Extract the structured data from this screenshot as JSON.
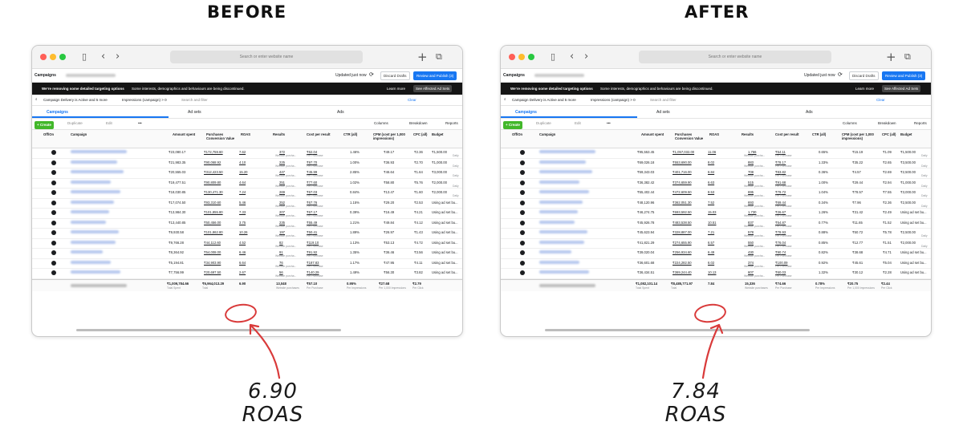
{
  "labels": {
    "before": "BEFORE",
    "after": "AFTER"
  },
  "annotations": {
    "before": {
      "value": "6.90",
      "unit": "ROAS"
    },
    "after": {
      "value": "7.84",
      "unit": "ROAS"
    }
  },
  "browser": {
    "address_placeholder": "Search or enter website name"
  },
  "manager": {
    "section": "Campaigns",
    "status": "Updated just now",
    "discard": "Discard Drafts",
    "review": "Review and Publish (3)",
    "notice_bold": "We're removing some detailed targeting options",
    "notice_text": "Some interests, demographics and behaviours are being discontinued.",
    "learn_more": "Learn more",
    "see_affected": "See Affected Ad Sets",
    "filter_chip1": "Campaign Delivery is Active and 5 more",
    "filter_chip2": "Impressions (campaign) > 0",
    "filter_hint": "Search and filter",
    "clear": "Clear",
    "tabs": [
      "Campaigns",
      "Ad sets",
      "Ads"
    ],
    "create": "+ Create",
    "duplicate": "Duplicate",
    "edit": "Edit",
    "more": "•••",
    "columns": "Columns",
    "breakdown": "Breakdown",
    "reports": "Reports",
    "headers": [
      "Off/On",
      "Campaign",
      "Amount spent",
      "Purchases Conversion Value",
      "ROAS",
      "Results",
      "Cost per result",
      "CTR (all)",
      "CPM (cost per 1,000 impressions)",
      "CPC (all)",
      "Budget"
    ],
    "results_sub": "Website purcha...",
    "cost_sub": "Per Purchase",
    "budget_sub": "Daily",
    "total_label": "Results from 1 campaign",
    "total_subs": [
      "Total Spent",
      "Total",
      "",
      "Website purchases",
      "Per Purchase",
      "Per Impressions",
      "Per 1,000 Impressions",
      "Per Click"
    ]
  },
  "before_table": {
    "rows": [
      [
        "₹23,080.17",
        "₹172,759.60",
        "7.62",
        "372",
        "₹62.04",
        "1.46%",
        "₹49.17",
        "₹2.36",
        "₹1,500.00"
      ],
      [
        "₹21,983.35",
        "₹90,068.92",
        "4.10",
        "225",
        "₹97.70",
        "1.00%",
        "₹36.93",
        "₹2.70",
        "₹1,000.00"
      ],
      [
        "₹20,555.03",
        "₹312,423.50",
        "15.20",
        "447",
        "₹45.99",
        "2.85%",
        "₹46.64",
        "₹1.64",
        "₹3,000.00"
      ],
      [
        "₹19,477.51",
        "₹90,809.80",
        "4.64",
        "251",
        "₹77.60",
        "1.02%",
        "₹58.80",
        "₹5.76",
        "₹2,000.00"
      ],
      [
        "₹18,030.85",
        "₹130,471.30",
        "7.24",
        "269",
        "₹67.03",
        "0.84%",
        "₹13.47",
        "₹1.60",
        "₹2,000.00"
      ],
      [
        "₹17,074.50",
        "₹93,310.60",
        "5.46",
        "252",
        "₹67.76",
        "1.15%",
        "₹29.20",
        "₹2.53",
        "Using ad set bu..."
      ],
      [
        "₹13,984.30",
        "₹101,855.80",
        "7.33",
        "207",
        "₹67.17",
        "0.39%",
        "₹16.49",
        "₹4.21",
        "Using ad set bu..."
      ],
      [
        "₹13,440.85",
        "₹50,456.00",
        "3.75",
        "235",
        "₹55.49",
        "1.21%",
        "₹49.84",
        "₹4.12",
        "Using ad set bu..."
      ],
      [
        "₹9,930.58",
        "₹101,862.80",
        "10.26",
        "197",
        "₹50.41",
        "1.89%",
        "₹26.97",
        "₹1.43",
        "Using ad set bu..."
      ],
      [
        "₹9,766.28",
        "₹44,112.60",
        "4.52",
        "82",
        "₹119.10",
        "1.13%",
        "₹53.13",
        "₹4.72",
        "Using ad set bu..."
      ],
      [
        "₹8,364.92",
        "₹54,008.00",
        "6.46",
        "91",
        "₹91.92",
        "1.35%",
        "₹36.46",
        "₹3.56",
        "Using ad set bu..."
      ],
      [
        "₹5,194.81",
        "₹34,903.90",
        "6.64",
        "76",
        "₹187.83",
        "1.17%",
        "₹47.95",
        "₹4.11",
        "Using ad set bu..."
      ],
      [
        "₹7,756.99",
        "₹20,697.50",
        "2.67",
        "56",
        "₹140.29",
        "1.49%",
        "₹56.30",
        "₹3.82",
        "Using ad set bu..."
      ]
    ],
    "total": [
      "₹1,009,784.66",
      "₹6,964,013.29",
      "6.90",
      "13,048",
      "₹57.10",
      "0.95%",
      "₹27.68",
      "₹2.79"
    ]
  },
  "after_table": {
    "rows": [
      [
        "₹95,553.45",
        "₹1,057,032.00",
        "11.06",
        "1,766",
        "₹54.11",
        "0.65%",
        "₹15.19",
        "₹1.09",
        "₹1,500.00"
      ],
      [
        "₹69,026.18",
        "₹553,690.00",
        "8.02",
        "883",
        "₹78.17",
        "1.33%",
        "₹35.22",
        "₹2.65",
        "₹3,500.00"
      ],
      [
        "₹59,343.03",
        "₹401,716.00",
        "6.84",
        "708",
        "₹83.82",
        "0.36%",
        "₹4.57",
        "₹2.69",
        "₹2,500.00"
      ],
      [
        "₹36,382.42",
        "₹374,659.90",
        "6.63",
        "515",
        "₹91.68",
        "1.00%",
        "₹29.44",
        "₹2.94",
        "₹1,000.00"
      ],
      [
        "₹55,402.44",
        "₹472,609.50",
        "8.53",
        "695",
        "₹79.72",
        "1.04%",
        "₹78.57",
        "₹7.55",
        "₹3,000.00"
      ],
      [
        "₹48,120.96",
        "₹362,051.30",
        "7.52",
        "693",
        "₹69.44",
        "0.34%",
        "₹7.96",
        "₹2.36",
        "₹2,500.00"
      ],
      [
        "₹46,274.75",
        "₹693,592.50",
        "15.03",
        "1,730",
        "₹26.67",
        "1.26%",
        "₹31.42",
        "₹2.49",
        "Using ad set bu..."
      ],
      [
        "₹45,926.78",
        "₹483,538.50",
        "10.51",
        "837",
        "₹54.87",
        "0.77%",
        "₹11.65",
        "₹1.52",
        "Using ad set bu..."
      ],
      [
        "₹45,623.94",
        "₹328,887.00",
        "7.21",
        "578",
        "₹78.93",
        "0.88%",
        "₹50.72",
        "₹5.78",
        "₹2,500.00"
      ],
      [
        "₹41,821.29",
        "₹274,655.90",
        "6.57",
        "550",
        "₹76.04",
        "0.85%",
        "₹12.77",
        "₹1.51",
        "₹2,000.00"
      ],
      [
        "₹39,020.04",
        "₹256,934.60",
        "6.49",
        "430",
        "₹90.74",
        "0.82%",
        "₹38.68",
        "₹4.71",
        "Using ad set bu..."
      ],
      [
        "₹36,601.68",
        "₹224,282.50",
        "6.02",
        "374",
        "₹100.09",
        "0.92%",
        "₹45.61",
        "₹5.04",
        "Using ad set bu..."
      ],
      [
        "₹36,434.51",
        "₹369,244.40",
        "10.13",
        "607",
        "₹60.03",
        "1.32%",
        "₹30.12",
        "₹2.28",
        "Using ad set bu..."
      ]
    ],
    "total": [
      "₹1,082,101.14",
      "₹8,485,771.97",
      "7.84",
      "15,336",
      "₹74.66",
      "0.78%",
      "₹20.75",
      "₹2.44"
    ]
  },
  "colors": {
    "accent": "#1877f2",
    "annotation": "#d93a3a",
    "create": "#42b72a"
  },
  "icons": [
    "sidebar-icon",
    "back-icon",
    "forward-icon",
    "plus-icon",
    "tabs-icon",
    "refresh-icon",
    "search-icon",
    "close-icon",
    "columns-icon",
    "breakdown-icon",
    "chevron-down-icon"
  ]
}
